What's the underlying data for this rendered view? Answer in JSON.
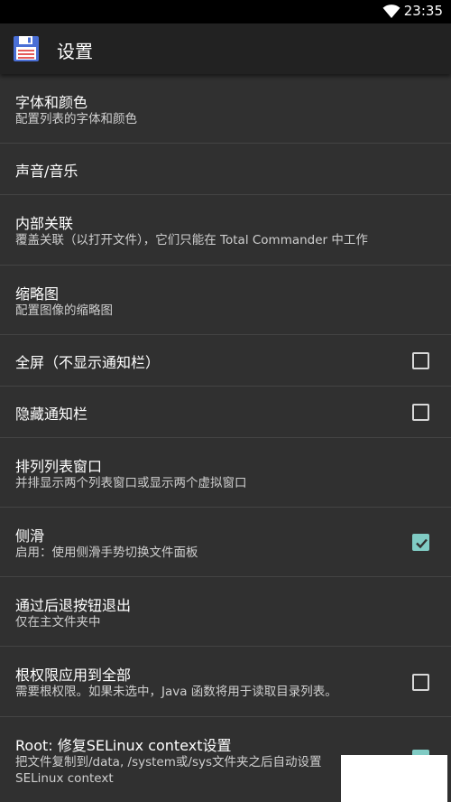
{
  "status_bar": {
    "time": "23:35",
    "wifi_icon": "wifi-icon"
  },
  "app_bar": {
    "title": "设置",
    "app_icon": "floppy-disk-icon"
  },
  "settings": [
    {
      "title": "字体和颜色",
      "subtitle": "配置列表的字体和颜色"
    },
    {
      "title": "声音/音乐"
    },
    {
      "title": "内部关联",
      "subtitle": "覆盖关联（以打开文件），它们只能在 Total Commander 中工作"
    },
    {
      "title": "缩略图",
      "subtitle": "配置图像的缩略图"
    },
    {
      "title": "全屏（不显示通知栏）",
      "checked": false
    },
    {
      "title": "隐藏通知栏",
      "checked": false
    },
    {
      "title": "排列列表窗口",
      "subtitle": "并排显示两个列表窗口或显示两个虚拟窗口"
    },
    {
      "title": "侧滑",
      "subtitle": "启用：使用侧滑手势切换文件面板",
      "checked": true
    },
    {
      "title": "通过后退按钮退出",
      "subtitle": "仅在主文件夹中"
    },
    {
      "title": "根权限应用到全部",
      "subtitle": "需要根权限。如果未选中，Java 函数将用于读取目录列表。",
      "checked": false
    },
    {
      "title": "Root: 修复SELinux context设置",
      "subtitle": "把文件复制到/data, /system或/sys文件夹之后自动设置",
      "subtitle2": "SELinux context",
      "checked": true
    }
  ],
  "colors": {
    "accent": "#80cbc4",
    "background": "#303030",
    "app_bar": "#222222"
  }
}
